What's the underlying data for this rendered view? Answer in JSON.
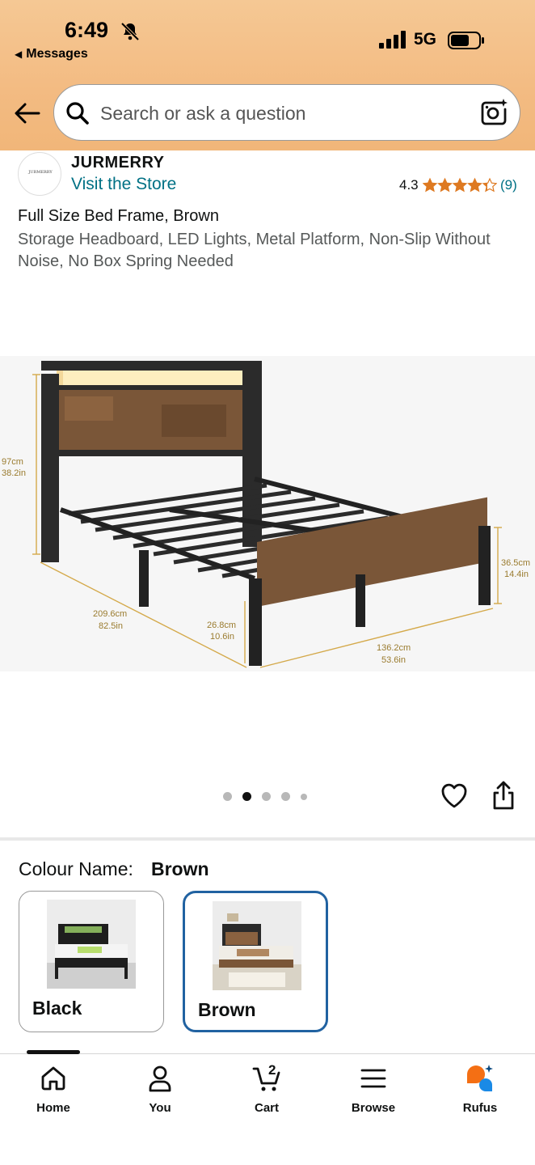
{
  "status_bar": {
    "time": "6:49",
    "back_app": "Messages",
    "network": "5G"
  },
  "search": {
    "placeholder": "Search or ask a question"
  },
  "brand": {
    "name": "JURMERRY",
    "logo_text": "JURMERRY",
    "visit_store": "Visit the Store",
    "rating": "4.3",
    "rating_count": "(9)",
    "stars_value": 4.3
  },
  "product": {
    "title": "Full Size Bed Frame, Brown",
    "subtitle": "Storage Headboard, LED Lights, Metal Platform, Non-Slip Without Noise, No Box Spring Needed",
    "dimensions": {
      "height_cm": "97cm",
      "height_in": "38.2in",
      "length_cm": "209.6cm",
      "length_in": "82.5in",
      "clearance_cm": "26.8cm",
      "clearance_in": "10.6in",
      "width_cm": "136.2cm",
      "width_in": "53.6in",
      "foot_cm": "36.5cm",
      "foot_in": "14.4in"
    },
    "image_index": 2,
    "image_count": 5
  },
  "variation": {
    "label": "Colour Name:",
    "selected": "Brown",
    "options": [
      {
        "label": "Black",
        "selected": false
      },
      {
        "label": "Brown",
        "selected": true
      }
    ]
  },
  "nav": {
    "items": [
      {
        "label": "Home",
        "icon": "home-icon"
      },
      {
        "label": "You",
        "icon": "person-icon"
      },
      {
        "label": "Cart",
        "icon": "cart-icon"
      },
      {
        "label": "Browse",
        "icon": "menu-icon"
      },
      {
        "label": "Rufus",
        "icon": "rufus-icon"
      }
    ],
    "cart_count": "2"
  },
  "colors": {
    "link": "#007185",
    "star": "#de7921",
    "selected_border": "#2162a1",
    "header_bg": "#f3bb82",
    "dimension_line": "#d4a94a"
  }
}
